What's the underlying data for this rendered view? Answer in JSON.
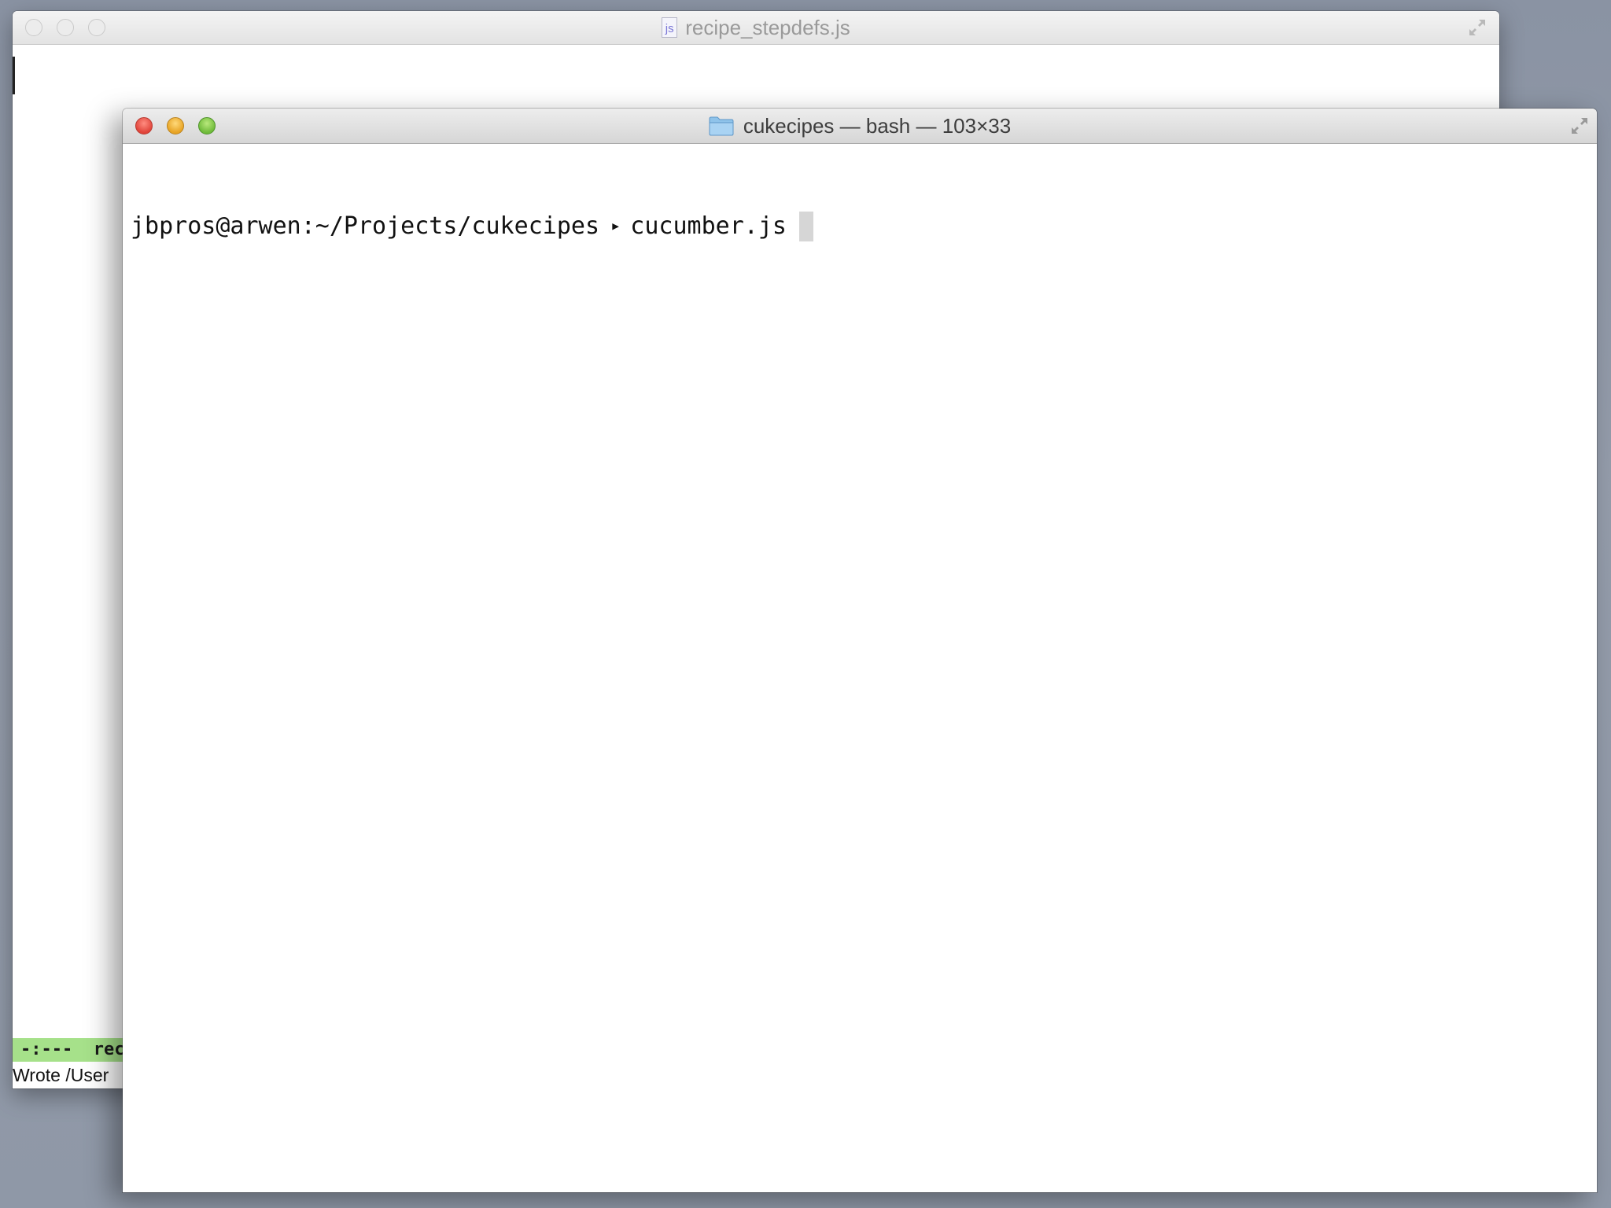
{
  "back_window": {
    "title": "recipe_stepdefs.js",
    "file_icon": "js",
    "modeline": "-:---  reci",
    "minibuffer": "Wrote /User"
  },
  "terminal": {
    "title": "cukecipes — bash — 103×33",
    "prompt": "jbpros@arwen:~/Projects/cukecipes",
    "caret": "▸",
    "command": "cucumber.js"
  },
  "icons": {
    "back_file": "js-file-icon",
    "folder": "folder-icon",
    "fullscreen": "fullscreen-icon"
  },
  "colors": {
    "close": "#e0443a",
    "minimize": "#e7a323",
    "maximize": "#6fbb3a",
    "modeline": "#a6e18a"
  }
}
